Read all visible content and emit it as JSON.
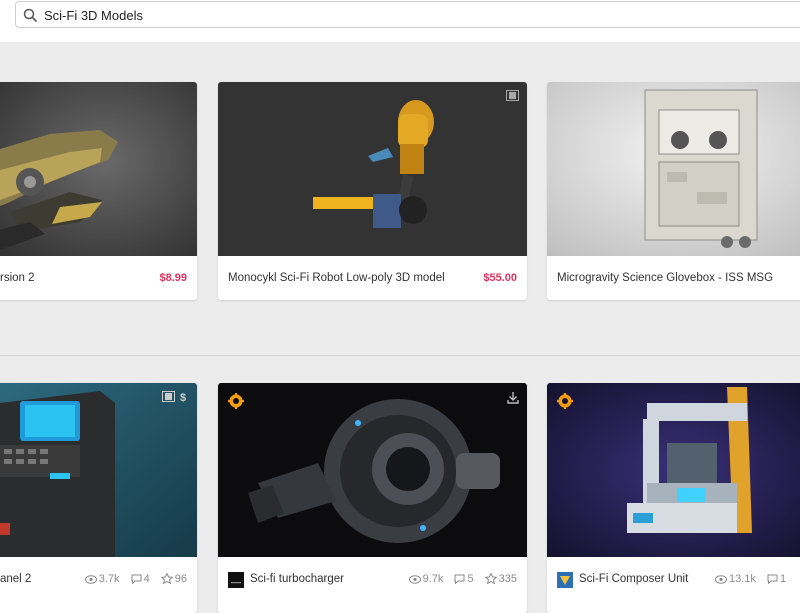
{
  "search": {
    "query": "Sci-Fi 3D Models"
  },
  "row1": [
    {
      "title": "rsion 2",
      "price": "$8.99"
    },
    {
      "title": "Monocykl Sci-Fi Robot Low-poly 3D model",
      "price": "$55.00"
    },
    {
      "title": "Microgravity Science Glovebox - ISS MSG"
    }
  ],
  "row2": [
    {
      "title": "anel 2",
      "views": "3.7k",
      "comments": "4",
      "likes": "96"
    },
    {
      "title": "Sci-fi turbocharger",
      "views": "9.7k",
      "comments": "5",
      "likes": "335"
    },
    {
      "title": "Sci-Fi Composer Unit",
      "views": "13.1k",
      "comments": "1"
    }
  ],
  "icons": {
    "search": "search-icon",
    "video": "film-icon",
    "dollar": "dollar-icon",
    "download": "download-icon",
    "staffpick": "staff-pick-gear-icon",
    "views": "eye-icon",
    "comments": "comment-icon",
    "likes": "star-icon"
  },
  "colors": {
    "price": "#e0325f",
    "staffpick": "#f39c12",
    "background": "#ececec"
  }
}
